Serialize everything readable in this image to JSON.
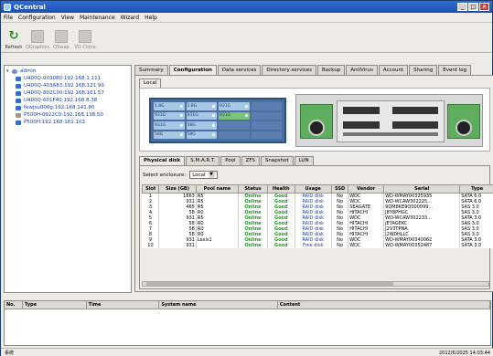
{
  "window": {
    "title": "QCentral"
  },
  "menu": [
    "File",
    "Configuration",
    "View",
    "Maintenance",
    "Wizard",
    "Help"
  ],
  "toolbar": [
    {
      "label": "Refresh",
      "icon": "refresh-icon",
      "enabled": true
    },
    {
      "label": "QGraphics",
      "icon": "graphics-icon",
      "enabled": false
    },
    {
      "label": "QSwap",
      "icon": "swap-icon",
      "enabled": false
    },
    {
      "label": "VD Clone",
      "icon": "clone-icon",
      "enabled": false
    }
  ],
  "tree": {
    "root": "admin",
    "items": [
      {
        "label": "U400Q-003080:192.168.1.111",
        "type": "blue"
      },
      {
        "label": "U400Q-403A83:192.168.121.99",
        "type": "blue"
      },
      {
        "label": "U400Q-802C00:192.168.161.57",
        "type": "blue"
      },
      {
        "label": "U400Q-601F40:192.168.8.38",
        "type": "blue"
      },
      {
        "label": "tewjsu000g:192.168.141.80",
        "type": "blue"
      },
      {
        "label": "P500H-0922C0:192.168.138.50",
        "type": "gray"
      },
      {
        "label": "P500H:192.168.161.103",
        "type": "blue"
      }
    ]
  },
  "tabs": [
    "Summary",
    "Configuration",
    "Data services",
    "Directory services",
    "Backup",
    "AntiVirus",
    "Account",
    "Sharing",
    "Event log"
  ],
  "active_tab": "Configuration",
  "local_tab": "Local",
  "bays": [
    {
      "label": "1.8G",
      "type": "n"
    },
    {
      "label": "1.8G",
      "type": "n"
    },
    {
      "label": "931G",
      "type": "n"
    },
    {
      "label": "",
      "type": "e"
    },
    {
      "label": "931G",
      "type": "n"
    },
    {
      "label": "931G",
      "type": "n"
    },
    {
      "label": "931G",
      "type": "g"
    },
    {
      "label": "",
      "type": "e"
    },
    {
      "label": "931G",
      "type": "n"
    },
    {
      "label": "58G",
      "type": "n"
    },
    {
      "label": "",
      "type": "e"
    },
    {
      "label": "",
      "type": "e"
    },
    {
      "label": "58G",
      "type": "n"
    },
    {
      "label": "58G",
      "type": "n"
    },
    {
      "label": "",
      "type": "e"
    },
    {
      "label": "",
      "type": "e"
    }
  ],
  "subtabs": [
    "Physical disk",
    "S.M.A.R.T.",
    "Pool",
    "ZFS",
    "Snapshot",
    "LUN"
  ],
  "active_subtab": "Physical disk",
  "enclosure_select": {
    "label": "Select enclosure:",
    "value": "Local"
  },
  "disk_table": {
    "headers": [
      "Slot",
      "Size (GB)",
      "Pool name",
      "Status",
      "Health",
      "Usage",
      "SSD",
      "Vendor",
      "Serial",
      "Type"
    ],
    "rows": [
      [
        "1",
        "1863",
        "R5",
        "Online",
        "Good",
        "RAID disk",
        "No",
        "WDC",
        "WD-WMAY00325935",
        "SATA 6.0"
      ],
      [
        "2",
        "931",
        "R5",
        "Online",
        "Good",
        "RAID disk",
        "No",
        "WDC",
        "WD-WCAW302225...",
        "SATA 6.0"
      ],
      [
        "3",
        "465",
        "R5",
        "Online",
        "Good",
        "RAID disk",
        "No",
        "SEAGATE",
        "9QM8KE9Q000099...",
        "SAS 3.0"
      ],
      [
        "4",
        "58",
        "R0",
        "Online",
        "Good",
        "RAID disk",
        "No",
        "HITACHI",
        "J8Y8PHGC",
        "SAS 3.0"
      ],
      [
        "5",
        "931",
        "R5",
        "Online",
        "Good",
        "RAID disk",
        "No",
        "WDC",
        "WD-WCAW302233...",
        "SATA 3.0"
      ],
      [
        "6",
        "58",
        "R0",
        "Online",
        "Good",
        "RAID disk",
        "No",
        "HITACHI",
        "JEYAGEKC",
        "SAS 3.0"
      ],
      [
        "7",
        "58",
        "R0",
        "Online",
        "Good",
        "RAID disk",
        "No",
        "HITACHI",
        "J2V3TPNA",
        "SAS 3.0"
      ],
      [
        "8",
        "58",
        "R0",
        "Online",
        "Good",
        "RAID disk",
        "No",
        "HITACHI",
        "J2W0HLLC",
        "SAS 3.0"
      ],
      [
        "9",
        "931",
        "Lexis1",
        "Online",
        "Good",
        "RAID disk",
        "No",
        "WDC",
        "WD-WMAY00340062",
        "SATA 3.0"
      ],
      [
        "10",
        "931",
        "",
        "Online",
        "Good",
        "Free disk",
        "No",
        "WDC",
        "WD-WMAY00352487",
        "SATA 3.0"
      ]
    ]
  },
  "log_table": {
    "headers": [
      "No.",
      "Type",
      "Time",
      "System name",
      "Content"
    ]
  },
  "status": {
    "left": "系统",
    "right": "2012/6/2025 14:03:44"
  }
}
